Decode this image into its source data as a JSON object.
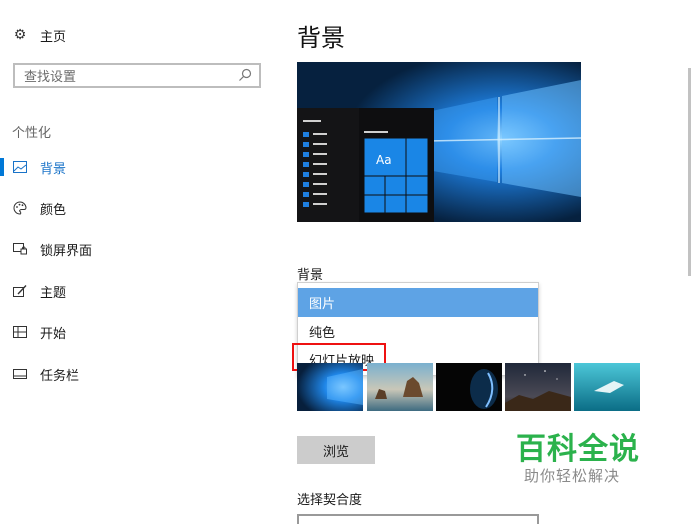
{
  "sidebar": {
    "home_label": "主页",
    "search_placeholder": "查找设置",
    "section_label": "个性化",
    "items": [
      {
        "label": "背景",
        "icon": "picture-icon",
        "active": true
      },
      {
        "label": "颜色",
        "icon": "palette-icon",
        "active": false
      },
      {
        "label": "锁屏界面",
        "icon": "lock-screen-icon",
        "active": false
      },
      {
        "label": "主题",
        "icon": "theme-icon",
        "active": false
      },
      {
        "label": "开始",
        "icon": "start-icon",
        "active": false
      },
      {
        "label": "任务栏",
        "icon": "taskbar-icon",
        "active": false
      }
    ]
  },
  "main": {
    "title": "背景",
    "preview": {
      "tile_text": "Aa"
    },
    "background_label": "背景",
    "dropdown_options": [
      "图片",
      "纯色",
      "幻灯片放映"
    ],
    "selected_option": "图片",
    "browse_label": "浏览",
    "fit_label": "选择契合度"
  },
  "watermark": {
    "title": "百科全说",
    "subtitle": "助你轻松解决"
  },
  "colors": {
    "accent": "#0078d7",
    "highlight": "#e11111",
    "watermark": "#2bb24c"
  }
}
